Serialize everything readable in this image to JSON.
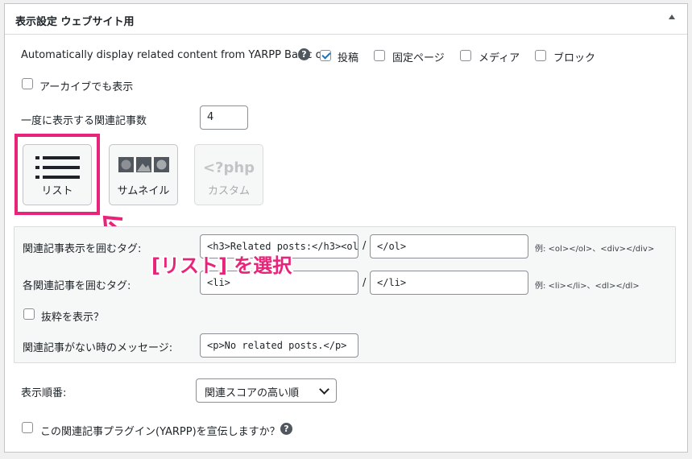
{
  "panel": {
    "title": "表示設定 ウェブサイト用"
  },
  "auto_display": {
    "label": "Automatically display related content from YARPP Basic on:",
    "options": [
      {
        "label": "投稿",
        "checked": true
      },
      {
        "label": "固定ページ",
        "checked": false
      },
      {
        "label": "メディア",
        "checked": false
      },
      {
        "label": "ブロック",
        "checked": false
      }
    ]
  },
  "archive": {
    "label": "アーカイブでも表示",
    "checked": false
  },
  "count": {
    "label": "一度に表示する関連記事数",
    "value": "4"
  },
  "templates": [
    {
      "label": "リスト",
      "icon": "list-icon",
      "selected": true
    },
    {
      "label": "サムネイル",
      "icon": "thumbnail-icon",
      "selected": false
    },
    {
      "label": "カスタム",
      "icon": "php-icon",
      "icon_text": "<?php",
      "disabled": true
    }
  ],
  "list_options": {
    "wrap_label": "関連記事表示を囲むタグ:",
    "wrap_before": "<h3>Related posts:</h3><ol",
    "wrap_after": "</ol>",
    "wrap_example": "例: <ol></ol>、<div></div>",
    "item_label": "各関連記事を囲むタグ:",
    "item_before": "<li>",
    "item_after": "</li>",
    "item_example": "例: <li></li>、<dl></dl>",
    "excerpt_label": "抜粋を表示？",
    "noresults_label": "関連記事がない時のメッセージ:",
    "noresults_value": "<p>No related posts.</p>",
    "slash": "/"
  },
  "order": {
    "label": "表示順番:",
    "value": "関連スコアの高い順"
  },
  "promote": {
    "label": "この関連記事プラグイン(YARPP)を宣伝しますか？"
  },
  "annotation": {
    "text": "[リスト] を選択"
  },
  "colors": {
    "accent": "#e8247a",
    "check": "#2271b1"
  }
}
